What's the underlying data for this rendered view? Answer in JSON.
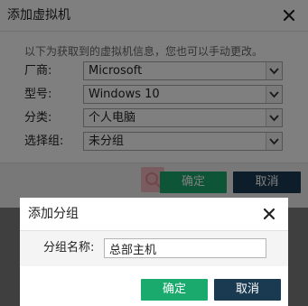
{
  "add_vm_dialog": {
    "title": "添加虚拟机",
    "close_icon": "close-icon",
    "description": "以下为获取到的虚拟机信息，您也可以手动更改。",
    "fields": [
      {
        "label": "厂商:",
        "value": "Microsoft"
      },
      {
        "label": "型号:",
        "value": "Windows 10"
      },
      {
        "label": "分类:",
        "value": "个人电脑"
      },
      {
        "label": "选择组:",
        "value": "未分组"
      }
    ],
    "ok_label": "确定",
    "cancel_label": "取消"
  },
  "add_group_dialog": {
    "title": "添加分组",
    "close_icon": "close-icon",
    "group_name_label": "分组名称:",
    "group_name_value": "总部主机",
    "ok_label": "确定",
    "cancel_label": "取消"
  },
  "colors": {
    "ok_button": "#1aaa6d",
    "cancel_button": "#1a3a52",
    "overlay": "rgba(0,0,0,0.5)"
  }
}
